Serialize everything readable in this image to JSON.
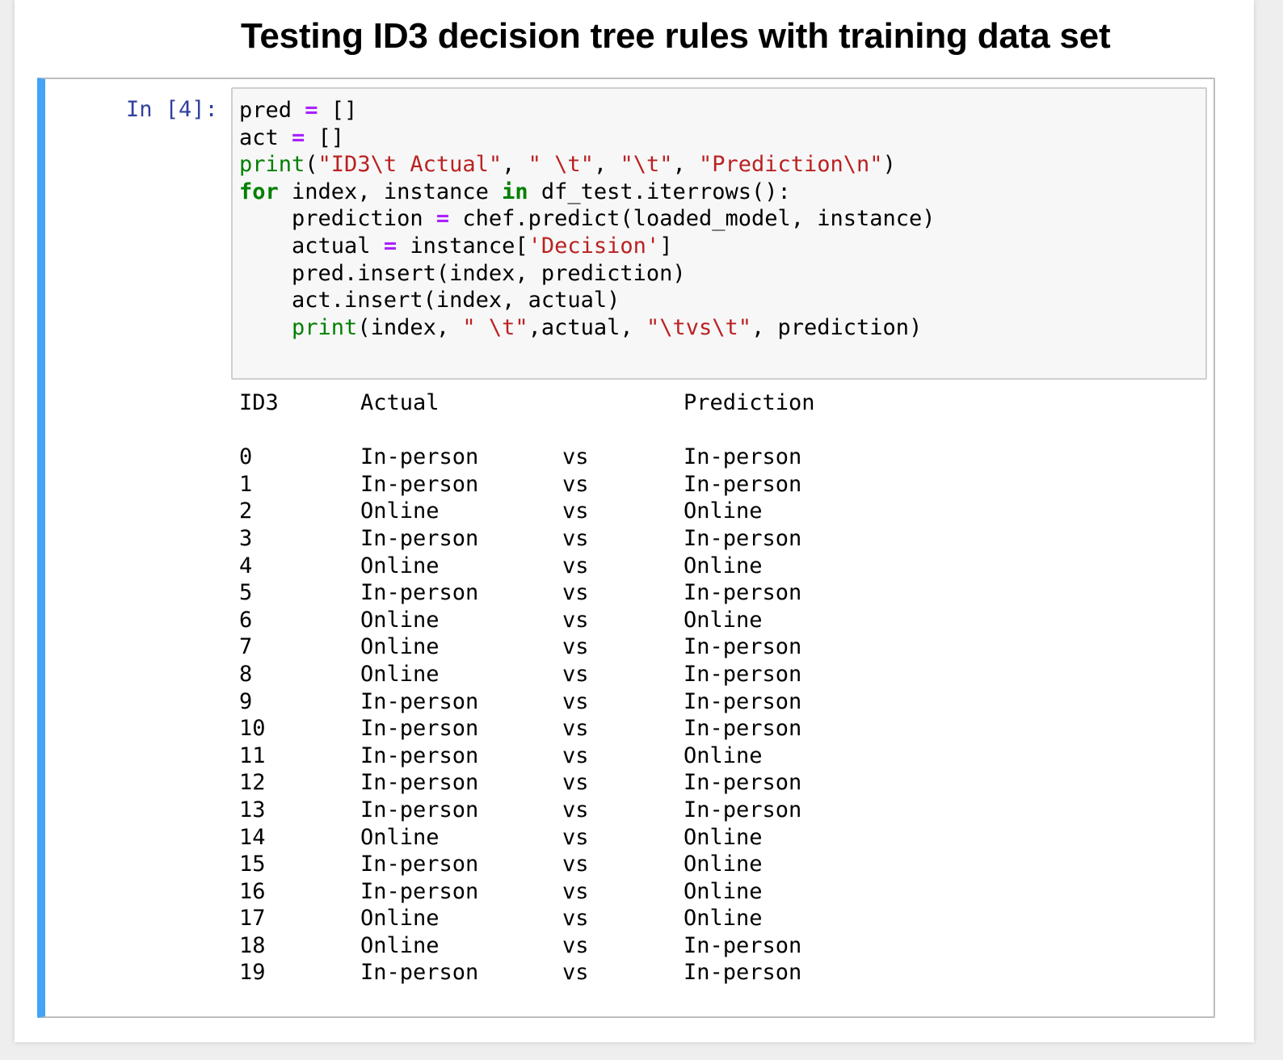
{
  "heading": "Testing ID3 decision tree rules with training data set",
  "cell": {
    "prompt": "In [4]:",
    "code_tokens": [
      [
        [
          "t",
          "pred "
        ],
        [
          "op",
          "="
        ],
        [
          "t",
          " []"
        ]
      ],
      [
        [
          "t",
          "act "
        ],
        [
          "op",
          "="
        ],
        [
          "t",
          " []"
        ]
      ],
      [
        [
          "bi",
          "print"
        ],
        [
          "t",
          "("
        ],
        [
          "str",
          "\"ID3\\t Actual\""
        ],
        [
          "t",
          ", "
        ],
        [
          "str",
          "\" \\t\""
        ],
        [
          "t",
          ", "
        ],
        [
          "str",
          "\"\\t\""
        ],
        [
          "t",
          ", "
        ],
        [
          "str",
          "\"Prediction\\n\""
        ],
        [
          "t",
          ")"
        ]
      ],
      [
        [
          "kw",
          "for"
        ],
        [
          "t",
          " index, instance "
        ],
        [
          "kw",
          "in"
        ],
        [
          "t",
          " df_test.iterrows():"
        ]
      ],
      [
        [
          "t",
          "    prediction "
        ],
        [
          "op",
          "="
        ],
        [
          "t",
          " chef.predict(loaded_model, instance)"
        ]
      ],
      [
        [
          "t",
          "    actual "
        ],
        [
          "op",
          "="
        ],
        [
          "t",
          " instance["
        ],
        [
          "str",
          "'Decision'"
        ],
        [
          "t",
          "]"
        ]
      ],
      [
        [
          "t",
          "    pred.insert(index, prediction)"
        ]
      ],
      [
        [
          "t",
          "    act.insert(index, actual)"
        ]
      ],
      [
        [
          "t",
          "    "
        ],
        [
          "bi",
          "print"
        ],
        [
          "t",
          "(index, "
        ],
        [
          "str",
          "\" \\t\""
        ],
        [
          "t",
          ",actual, "
        ],
        [
          "str",
          "\"\\tvs\\t\""
        ],
        [
          "t",
          ", prediction)"
        ]
      ]
    ]
  },
  "output": {
    "headers": {
      "index": "ID3",
      "actual": "Actual",
      "prediction": "Prediction"
    },
    "rows": [
      {
        "index": "0",
        "actual": "In-person",
        "vs": "vs",
        "prediction": "In-person"
      },
      {
        "index": "1",
        "actual": "In-person",
        "vs": "vs",
        "prediction": "In-person"
      },
      {
        "index": "2",
        "actual": "Online",
        "vs": "vs",
        "prediction": "Online"
      },
      {
        "index": "3",
        "actual": "In-person",
        "vs": "vs",
        "prediction": "In-person"
      },
      {
        "index": "4",
        "actual": "Online",
        "vs": "vs",
        "prediction": "Online"
      },
      {
        "index": "5",
        "actual": "In-person",
        "vs": "vs",
        "prediction": "In-person"
      },
      {
        "index": "6",
        "actual": "Online",
        "vs": "vs",
        "prediction": "Online"
      },
      {
        "index": "7",
        "actual": "Online",
        "vs": "vs",
        "prediction": "In-person"
      },
      {
        "index": "8",
        "actual": "Online",
        "vs": "vs",
        "prediction": "In-person"
      },
      {
        "index": "9",
        "actual": "In-person",
        "vs": "vs",
        "prediction": "In-person"
      },
      {
        "index": "10",
        "actual": "In-person",
        "vs": "vs",
        "prediction": "In-person"
      },
      {
        "index": "11",
        "actual": "In-person",
        "vs": "vs",
        "prediction": "Online"
      },
      {
        "index": "12",
        "actual": "In-person",
        "vs": "vs",
        "prediction": "In-person"
      },
      {
        "index": "13",
        "actual": "In-person",
        "vs": "vs",
        "prediction": "In-person"
      },
      {
        "index": "14",
        "actual": "Online",
        "vs": "vs",
        "prediction": "Online"
      },
      {
        "index": "15",
        "actual": "In-person",
        "vs": "vs",
        "prediction": "Online"
      },
      {
        "index": "16",
        "actual": "In-person",
        "vs": "vs",
        "prediction": "Online"
      },
      {
        "index": "17",
        "actual": "Online",
        "vs": "vs",
        "prediction": "Online"
      },
      {
        "index": "18",
        "actual": "Online",
        "vs": "vs",
        "prediction": "In-person"
      },
      {
        "index": "19",
        "actual": "In-person",
        "vs": "vs",
        "prediction": "In-person"
      }
    ]
  },
  "colors": {
    "cell_selected_bar": "#42a5f5",
    "prompt": "#303f9f",
    "keyword": "#008000",
    "builtin": "#008000",
    "string": "#ba2121",
    "operator": "#aa22ff"
  }
}
